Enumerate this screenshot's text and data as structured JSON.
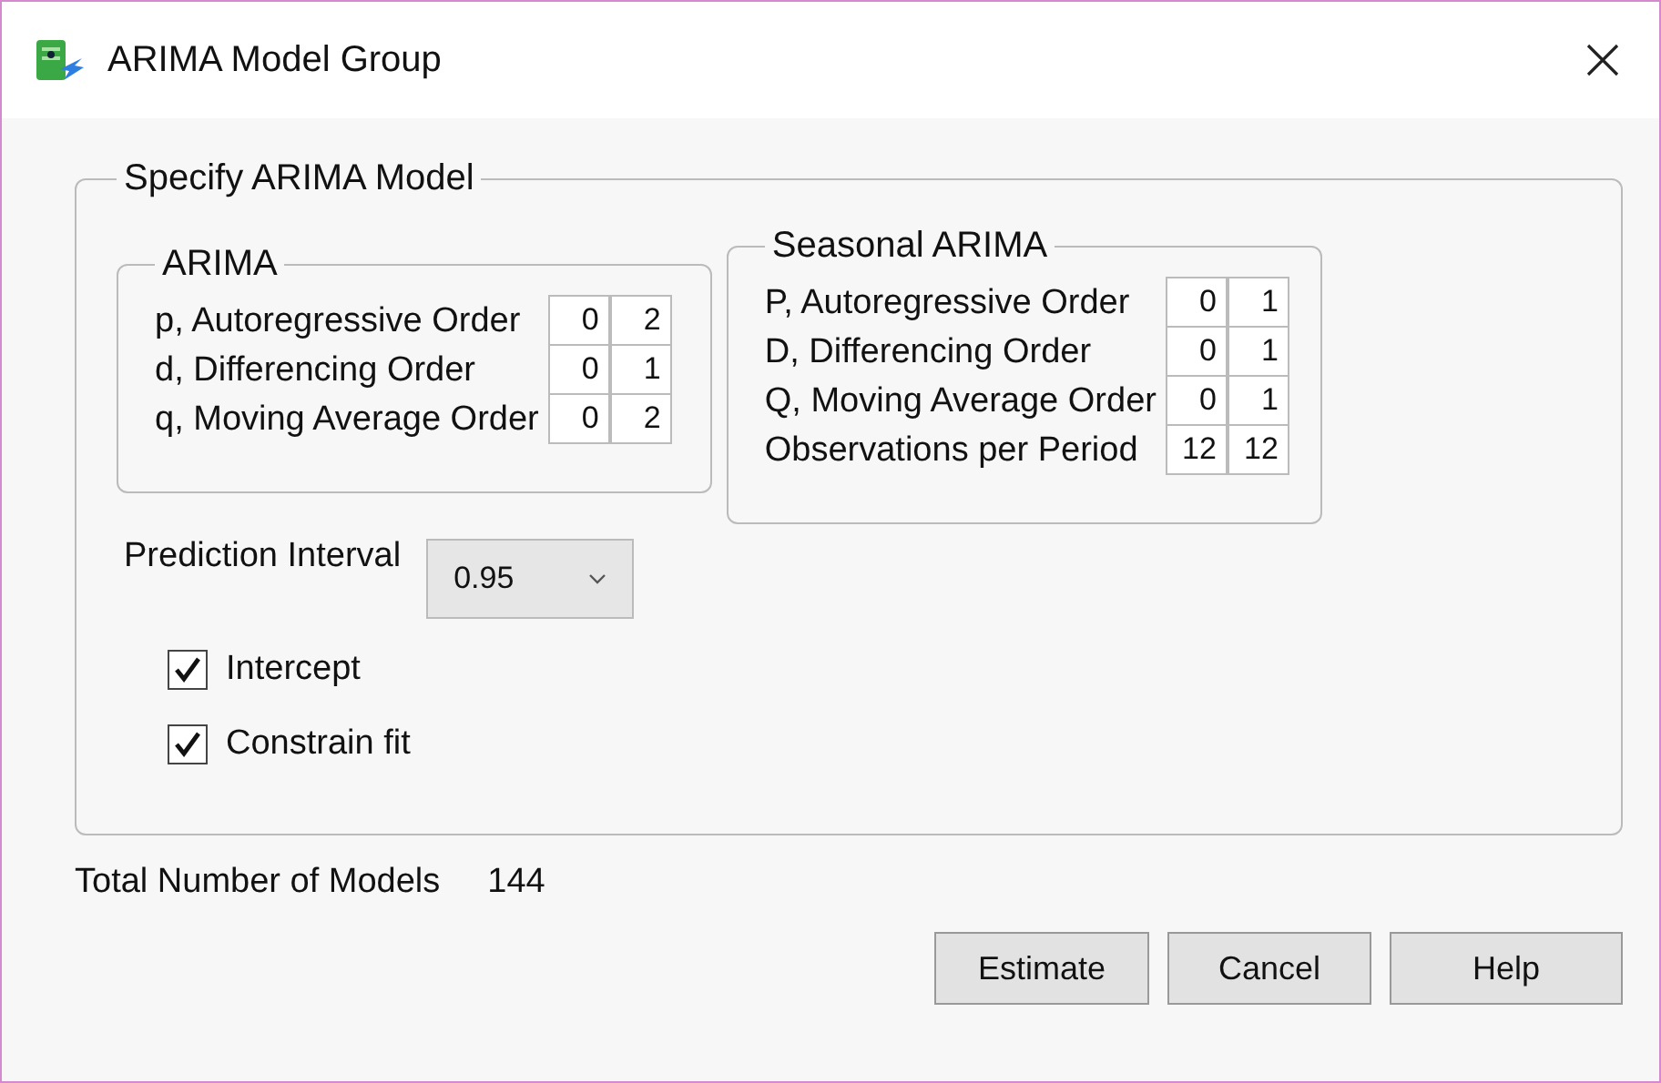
{
  "window": {
    "title": "ARIMA Model Group"
  },
  "specify_group": {
    "title": "Specify ARIMA Model",
    "arima": {
      "title": "ARIMA",
      "rows": [
        {
          "label": "p, Autoregressive Order",
          "from": "0",
          "to": "2"
        },
        {
          "label": "d, Differencing Order",
          "from": "0",
          "to": "1"
        },
        {
          "label": "q, Moving Average Order",
          "from": "0",
          "to": "2"
        }
      ]
    },
    "seasonal_arima": {
      "title": "Seasonal ARIMA",
      "rows": [
        {
          "label": "P, Autoregressive Order",
          "from": "0",
          "to": "1"
        },
        {
          "label": "D, Differencing Order",
          "from": "0",
          "to": "1"
        },
        {
          "label": "Q, Moving Average Order",
          "from": "0",
          "to": "1"
        },
        {
          "label": "Observations per Period",
          "from": "12",
          "to": "12"
        }
      ]
    },
    "prediction_interval": {
      "label": "Prediction Interval",
      "value": "0.95"
    },
    "options": [
      {
        "label": "Intercept",
        "checked": true
      },
      {
        "label": "Constrain fit",
        "checked": true
      }
    ]
  },
  "total_models": {
    "label": "Total Number of Models",
    "value": "144"
  },
  "buttons": [
    "Estimate",
    "Cancel",
    "Help"
  ]
}
